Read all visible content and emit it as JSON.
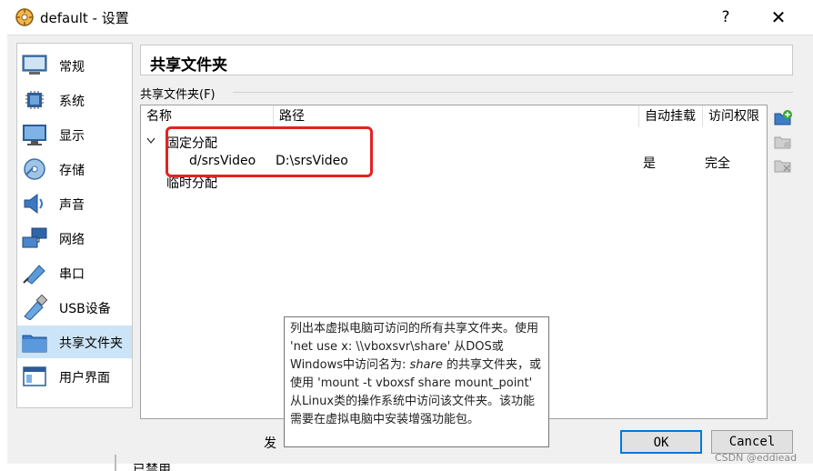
{
  "window": {
    "title": "default - 设置",
    "help": "?",
    "close": "✕"
  },
  "sidebar": {
    "items": [
      {
        "label": "常规",
        "icon": "general-icon"
      },
      {
        "label": "系统",
        "icon": "system-icon"
      },
      {
        "label": "显示",
        "icon": "display-icon"
      },
      {
        "label": "存储",
        "icon": "storage-icon"
      },
      {
        "label": "声音",
        "icon": "audio-icon"
      },
      {
        "label": "网络",
        "icon": "network-icon"
      },
      {
        "label": "串口",
        "icon": "serial-port-icon"
      },
      {
        "label": "USB设备",
        "icon": "usb-icon"
      },
      {
        "label": "共享文件夹",
        "icon": "shared-folder-icon",
        "selected": true
      },
      {
        "label": "用户界面",
        "icon": "user-interface-icon"
      }
    ]
  },
  "panel": {
    "title": "共享文件夹",
    "group_label": "共享文件夹(F)"
  },
  "table": {
    "columns": [
      "名称",
      "路径",
      "自动挂载",
      "访问权限"
    ],
    "group_fixed": "固定分配",
    "group_temp": "临时分配",
    "rows": [
      {
        "name": "d/srsVideo",
        "path": "D:\\srsVideo",
        "automount": "是",
        "access": "完全"
      }
    ]
  },
  "tooltip": {
    "part1": "列出本虚拟电脑可访问的所有共享文件夹。使用 'net use x: \\\\vboxsvr\\share' 从DOS或Windows中访问名为: ",
    "italic": "share",
    "part2": " 的共享文件夹，或使用 'mount -t vboxsf share mount_point' 从Linux类的操作系统中访问该文件夹。该功能需要在虚拟电脑中安装增强功能包。"
  },
  "footer": {
    "partial_text": "发",
    "ok": "OK",
    "cancel": "Cancel",
    "below_text": "已禁用"
  },
  "watermark": "CSDN @eddiead",
  "colors": {
    "selection": "#cce4f7",
    "highlight_border": "#e32222",
    "ok_border": "#0078d7"
  }
}
